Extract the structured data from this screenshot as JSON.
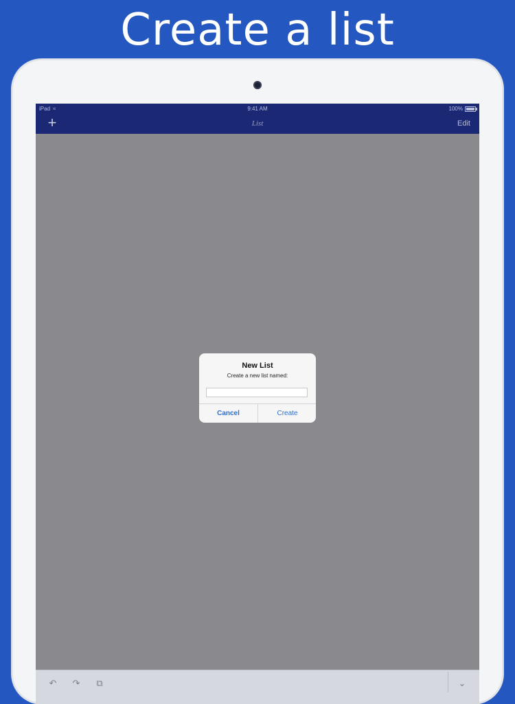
{
  "promo": {
    "headline": "Create a list"
  },
  "status_bar": {
    "device": "iPad",
    "time": "9:41 AM",
    "battery": "100%"
  },
  "nav_bar": {
    "add_icon": "+",
    "title": "List",
    "edit_label": "Edit"
  },
  "dialog": {
    "title": "New List",
    "message": "Create a new list named:",
    "input_value": "",
    "cancel_label": "Cancel",
    "create_label": "Create"
  },
  "toolbar": {
    "undo_icon": "↶",
    "redo_icon": "↷",
    "copy_icon": "⧉",
    "collapse_icon": "⌄"
  },
  "colors": {
    "background": "#2457bf",
    "nav_bar": "#1b2874",
    "overlay": "#8a898d",
    "accent": "#2d6fd1"
  }
}
